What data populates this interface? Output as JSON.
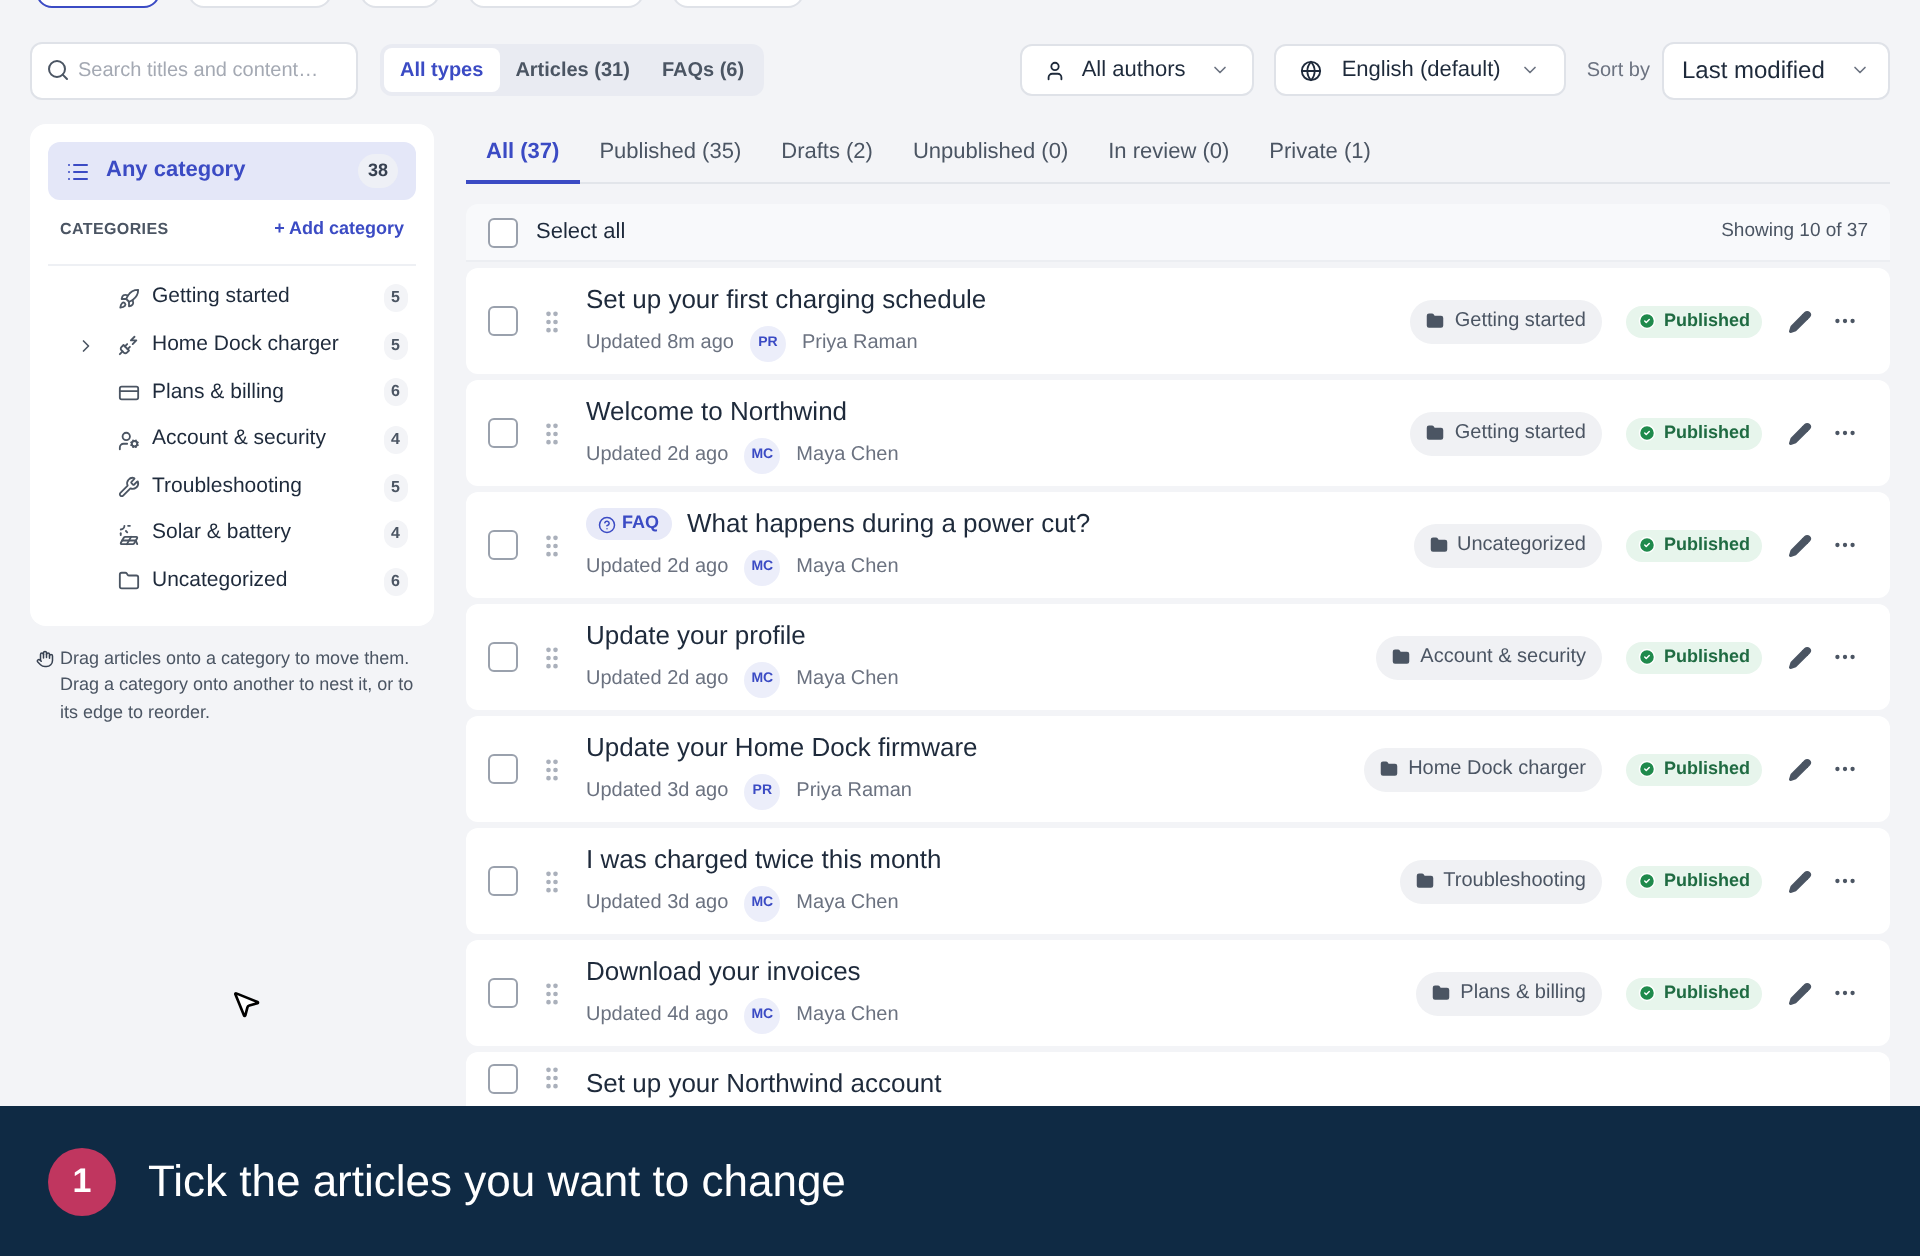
{
  "top_tabs": [
    {
      "selected": true
    },
    {
      "selected": false
    },
    {
      "selected": false
    },
    {
      "selected": false
    },
    {
      "selected": false
    }
  ],
  "search": {
    "placeholder": "Search titles and content…"
  },
  "type_filter": [
    {
      "label": "All types",
      "selected": true
    },
    {
      "label": "Articles (31)",
      "selected": false
    },
    {
      "label": "FAQs (6)",
      "selected": false
    }
  ],
  "author_filter": "All authors",
  "language_filter": "English (default)",
  "sort": {
    "label": "Sort by",
    "value": "Last modified"
  },
  "sidebar": {
    "any_category": {
      "label": "Any category",
      "count": "38",
      "selected": true
    },
    "heading": "CATEGORIES",
    "add_button": "+ Add category",
    "categories": [
      {
        "name": "Getting started",
        "count": "5",
        "has_subcategories": false,
        "selected": false
      },
      {
        "name": "Home Dock charger",
        "count": "5",
        "has_subcategories": true,
        "selected": false
      },
      {
        "name": "Plans & billing",
        "count": "6",
        "has_subcategories": false,
        "selected": false
      },
      {
        "name": "Account & security",
        "count": "4",
        "has_subcategories": false,
        "selected": false
      },
      {
        "name": "Troubleshooting",
        "count": "5",
        "has_subcategories": false,
        "selected": false
      },
      {
        "name": "Solar & battery",
        "count": "4",
        "has_subcategories": false,
        "selected": false
      },
      {
        "name": "Uncategorized",
        "count": "6",
        "has_subcategories": false,
        "selected": false
      }
    ],
    "hint": "Drag articles onto a category to move them. Drag a category onto another to nest it, or to its edge to reorder."
  },
  "status_tabs": [
    {
      "label": "All (37)",
      "selected": true
    },
    {
      "label": "Published (35)",
      "selected": false
    },
    {
      "label": "Drafts (2)",
      "selected": false
    },
    {
      "label": "Unpublished (0)",
      "selected": false
    },
    {
      "label": "In review (0)",
      "selected": false
    },
    {
      "label": "Private (1)",
      "selected": false
    }
  ],
  "list_header": {
    "select_all": "Select all",
    "checked": false,
    "showing": "Showing 10 of 37"
  },
  "articles": [
    {
      "kind": "article",
      "title": "Set up your first charging schedule",
      "updated": "Updated 8m ago",
      "initials": "PR",
      "author": "Priya Raman",
      "category": "Getting started",
      "status": "Published",
      "checked": false
    },
    {
      "kind": "article",
      "title": "Welcome to Northwind",
      "updated": "Updated 2d ago",
      "initials": "MC",
      "author": "Maya Chen",
      "category": "Getting started",
      "status": "Published",
      "checked": false
    },
    {
      "kind": "faq",
      "badge": "FAQ",
      "title": "What happens during a power cut?",
      "updated": "Updated 2d ago",
      "initials": "MC",
      "author": "Maya Chen",
      "category": "Uncategorized",
      "status": "Published",
      "checked": false
    },
    {
      "kind": "article",
      "title": "Update your profile",
      "updated": "Updated 2d ago",
      "initials": "MC",
      "author": "Maya Chen",
      "category": "Account & security",
      "status": "Published",
      "checked": false
    },
    {
      "kind": "article",
      "title": "Update your Home Dock firmware",
      "updated": "Updated 3d ago",
      "initials": "PR",
      "author": "Priya Raman",
      "category": "Home Dock charger",
      "status": "Published",
      "checked": false
    },
    {
      "kind": "article",
      "title": "I was charged twice this month",
      "updated": "Updated 3d ago",
      "initials": "MC",
      "author": "Maya Chen",
      "category": "Troubleshooting",
      "status": "Published",
      "checked": false
    },
    {
      "kind": "article",
      "title": "Download your invoices",
      "updated": "Updated 4d ago",
      "initials": "MC",
      "author": "Maya Chen",
      "category": "Plans & billing",
      "status": "Published",
      "checked": false
    },
    {
      "kind": "partial",
      "title": "Set up your Northwind account",
      "checked": false
    }
  ],
  "banner": {
    "step": "1",
    "text": "Tick the articles you want to change"
  }
}
